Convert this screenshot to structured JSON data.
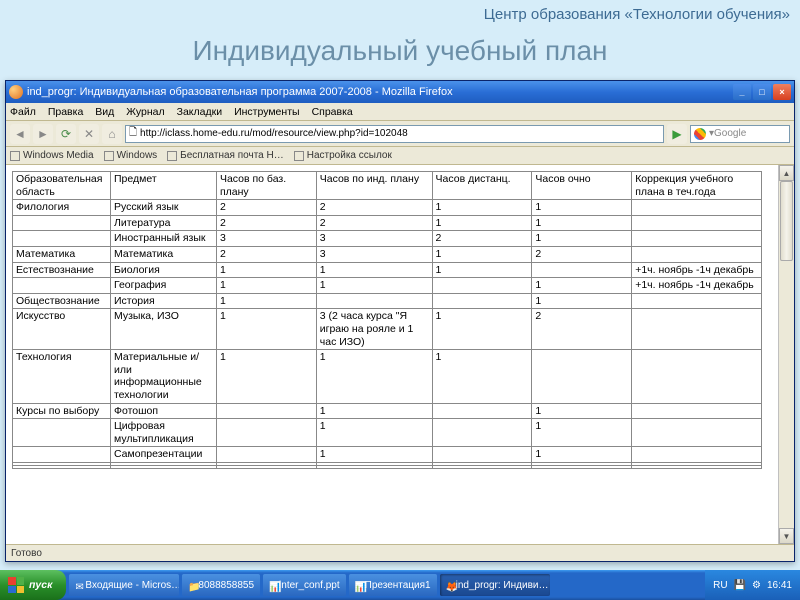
{
  "slide": {
    "header": "Центр образования «Технологии обучения»",
    "title": "Индивидуальный учебный план"
  },
  "browser": {
    "title": "ind_progr: Индивидуальная образовательная программа 2007-2008 - Mozilla Firefox",
    "menu": [
      "Файл",
      "Правка",
      "Вид",
      "Журнал",
      "Закладки",
      "Инструменты",
      "Справка"
    ],
    "url": "http://iclass.home-edu.ru/mod/resource/view.php?id=102048",
    "searchPlaceholder": "Google",
    "bookmarks": [
      "Windows Media",
      "Windows",
      "Бесплатная почта H…",
      "Настройка ссылок"
    ],
    "status": "Готово"
  },
  "table": {
    "headers": [
      "Образовательная область",
      "Предмет",
      "Часов по баз. плану",
      "Часов по инд. плану",
      "Часов дистанц.",
      "Часов очно",
      "Коррекция учебного плана в теч.года"
    ],
    "rows": [
      [
        "Филология",
        "Русский язык",
        "2",
        "2",
        "1",
        "1",
        ""
      ],
      [
        "",
        "Литература",
        "2",
        "2",
        "1",
        "1",
        ""
      ],
      [
        "",
        "Иностранный язык",
        "3",
        "3",
        "2",
        "1",
        ""
      ],
      [
        "Математика",
        "Математика",
        "2",
        "3",
        "1",
        "2",
        ""
      ],
      [
        "Естествознание",
        "Биология",
        "1",
        "1",
        "1",
        "",
        "+1ч. ноябрь -1ч декабрь"
      ],
      [
        "",
        "География",
        "1",
        "1",
        "",
        "1",
        "+1ч. ноябрь -1ч декабрь"
      ],
      [
        "Обществознание",
        "История",
        "1",
        "",
        "",
        "1",
        ""
      ],
      [
        "Искусство",
        "Музыка, ИЗО",
        "1",
        "3 (2 часа курса \"Я играю на рояле и 1 час ИЗО)",
        "1",
        "2",
        ""
      ],
      [
        "Технология",
        "Материальные и/или информационные технологии",
        "1",
        "1",
        "1",
        "",
        ""
      ],
      [
        "Курсы по выбору",
        "Фотошоп",
        "",
        "1",
        "",
        "1",
        ""
      ],
      [
        "",
        "Цифровая мультипликация",
        "",
        "1",
        "",
        "1",
        ""
      ],
      [
        "",
        "Самопрезентации",
        "",
        "1",
        "",
        "1",
        ""
      ],
      [
        "",
        "",
        "",
        "",
        "",
        "",
        ""
      ],
      [
        "",
        "",
        "",
        "",
        "",
        "",
        ""
      ]
    ]
  },
  "taskbar": {
    "start": "пуск",
    "items": [
      "Входящие - Micros…",
      "8088858855",
      "inter_conf.ppt",
      "Презентация1",
      "ind_progr: Индиви…"
    ],
    "lang": "RU",
    "time": "16:41"
  }
}
